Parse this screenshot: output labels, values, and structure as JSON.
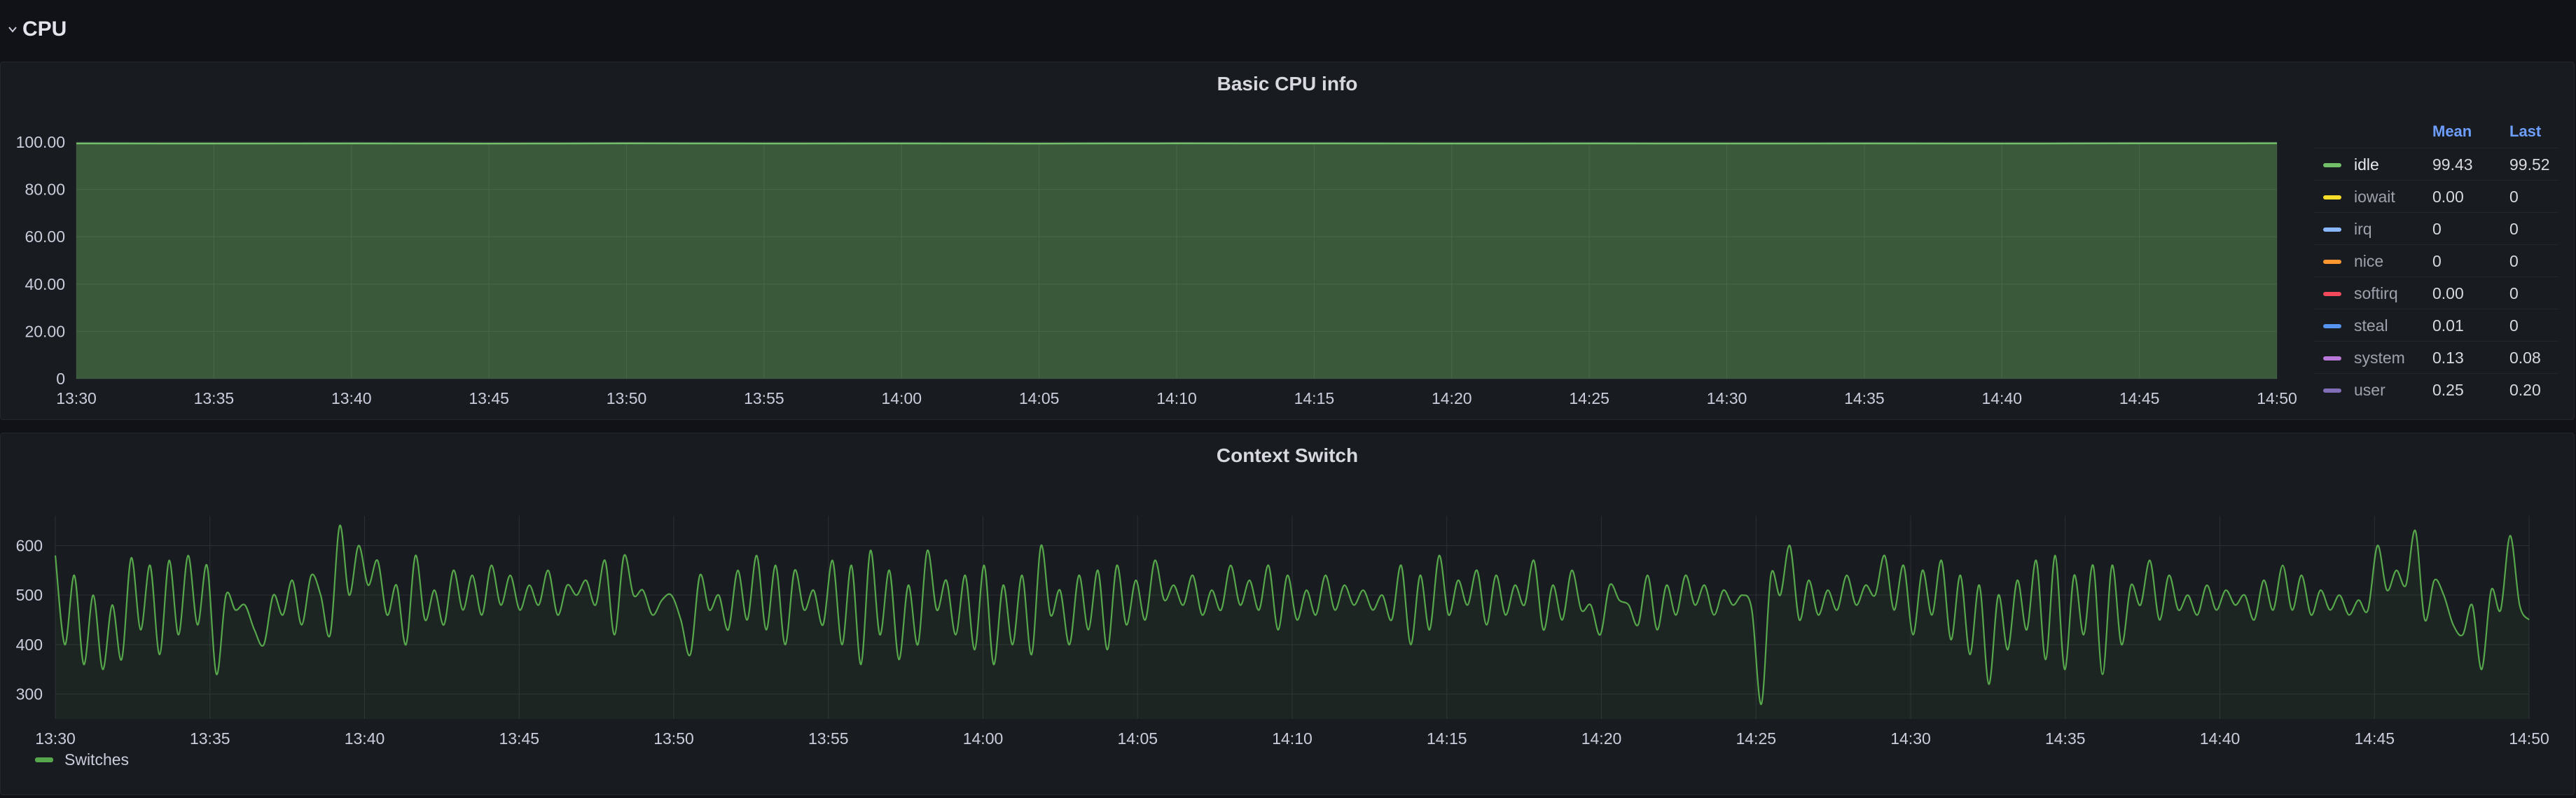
{
  "row": {
    "title": "CPU",
    "chevron_icon": "chevron-down-icon"
  },
  "colors": {
    "background": "#111217",
    "panel": "#181b1f",
    "grid": "#2c2f36",
    "idle": "#73bf69",
    "switches": "#56a64b",
    "header_blue": "#6e9fff"
  },
  "legend_table": {
    "headers": [
      "Mean",
      "Last"
    ],
    "rows": [
      {
        "name": "idle",
        "color": "#73bf69",
        "mean": "99.43",
        "last": "99.52"
      },
      {
        "name": "iowait",
        "color": "#fade2a",
        "mean": "0.00",
        "last": "0"
      },
      {
        "name": "irq",
        "color": "#8ab8ff",
        "mean": "0",
        "last": "0"
      },
      {
        "name": "nice",
        "color": "#ff9830",
        "mean": "0",
        "last": "0"
      },
      {
        "name": "softirq",
        "color": "#f2495c",
        "mean": "0.00",
        "last": "0"
      },
      {
        "name": "steal",
        "color": "#5794f2",
        "mean": "0.01",
        "last": "0"
      },
      {
        "name": "system",
        "color": "#b877d9",
        "mean": "0.13",
        "last": "0.08"
      },
      {
        "name": "user",
        "color": "#806eb7",
        "mean": "0.25",
        "last": "0.20"
      }
    ]
  },
  "chart_data": [
    {
      "type": "area",
      "title": "Basic CPU info",
      "xlabel": "",
      "ylabel": "",
      "x_ticks": [
        "13:30",
        "13:35",
        "13:40",
        "13:45",
        "13:50",
        "13:55",
        "14:00",
        "14:05",
        "14:10",
        "14:15",
        "14:20",
        "14:25",
        "14:30",
        "14:35",
        "14:40",
        "14:45",
        "14:50"
      ],
      "y_ticks": [
        "0",
        "20.00",
        "40.00",
        "60.00",
        "80.00",
        "100.00"
      ],
      "ylim": [
        0,
        100
      ],
      "grid": true,
      "legend": "right",
      "series": [
        {
          "name": "idle",
          "color": "#73bf69",
          "values": [
            99.43,
            99.4,
            99.45,
            99.38,
            99.46,
            99.42,
            99.44,
            99.39,
            99.47,
            99.43,
            99.41,
            99.45,
            99.42,
            99.44,
            99.4,
            99.46,
            99.52
          ]
        }
      ]
    },
    {
      "type": "line",
      "title": "Context Switch",
      "xlabel": "",
      "ylabel": "",
      "x_ticks": [
        "13:30",
        "13:35",
        "13:40",
        "13:45",
        "13:50",
        "13:55",
        "14:00",
        "14:05",
        "14:10",
        "14:15",
        "14:20",
        "14:25",
        "14:30",
        "14:35",
        "14:40",
        "14:45",
        "14:50"
      ],
      "y_ticks": [
        "300",
        "400",
        "500",
        "600"
      ],
      "ylim": [
        250,
        660
      ],
      "grid": true,
      "legend": "bottom-left",
      "series": [
        {
          "name": "Switches",
          "color": "#56a64b",
          "values": [
            580,
            400,
            540,
            360,
            500,
            350,
            480,
            370,
            575,
            430,
            560,
            380,
            570,
            420,
            580,
            440,
            560,
            340,
            500,
            470,
            480,
            430,
            400,
            500,
            460,
            530,
            440,
            540,
            500,
            420,
            640,
            500,
            600,
            520,
            570,
            460,
            520,
            400,
            580,
            450,
            510,
            440,
            550,
            470,
            540,
            460,
            560,
            480,
            540,
            470,
            520,
            480,
            550,
            460,
            520,
            500,
            530,
            480,
            570,
            420,
            580,
            500,
            510,
            460,
            490,
            500,
            450,
            380,
            540,
            470,
            500,
            430,
            550,
            450,
            580,
            430,
            560,
            400,
            550,
            470,
            510,
            440,
            570,
            400,
            560,
            360,
            590,
            420,
            550,
            370,
            520,
            400,
            590,
            470,
            530,
            420,
            540,
            390,
            560,
            360,
            520,
            400,
            540,
            380,
            600,
            460,
            510,
            400,
            540,
            430,
            550,
            390,
            560,
            440,
            530,
            450,
            570,
            490,
            520,
            480,
            540,
            460,
            510,
            470,
            560,
            480,
            530,
            470,
            560,
            430,
            540,
            450,
            510,
            460,
            540,
            470,
            520,
            480,
            510,
            470,
            500,
            450,
            560,
            400,
            540,
            430,
            580,
            460,
            530,
            480,
            550,
            440,
            540,
            460,
            520,
            480,
            570,
            430,
            520,
            450,
            550,
            470,
            480,
            420,
            520,
            490,
            480,
            440,
            540,
            430,
            520,
            460,
            540,
            480,
            520,
            460,
            510,
            480,
            500,
            470,
            280,
            540,
            500,
            600,
            450,
            530,
            460,
            510,
            470,
            540,
            480,
            520,
            500,
            580,
            470,
            560,
            420,
            550,
            460,
            570,
            410,
            540,
            380,
            520,
            320,
            500,
            390,
            530,
            430,
            570,
            370,
            580,
            350,
            540,
            420,
            560,
            340,
            560,
            400,
            520,
            480,
            570,
            450,
            540,
            470,
            500,
            460,
            520,
            470,
            510,
            480,
            500,
            450,
            530,
            470,
            560,
            470,
            540,
            460,
            510,
            470,
            500,
            460,
            490,
            470,
            600,
            510,
            550,
            520,
            630,
            450,
            530,
            500,
            440,
            420,
            480,
            350,
            510,
            470,
            620,
            480,
            450
          ]
        }
      ]
    }
  ]
}
